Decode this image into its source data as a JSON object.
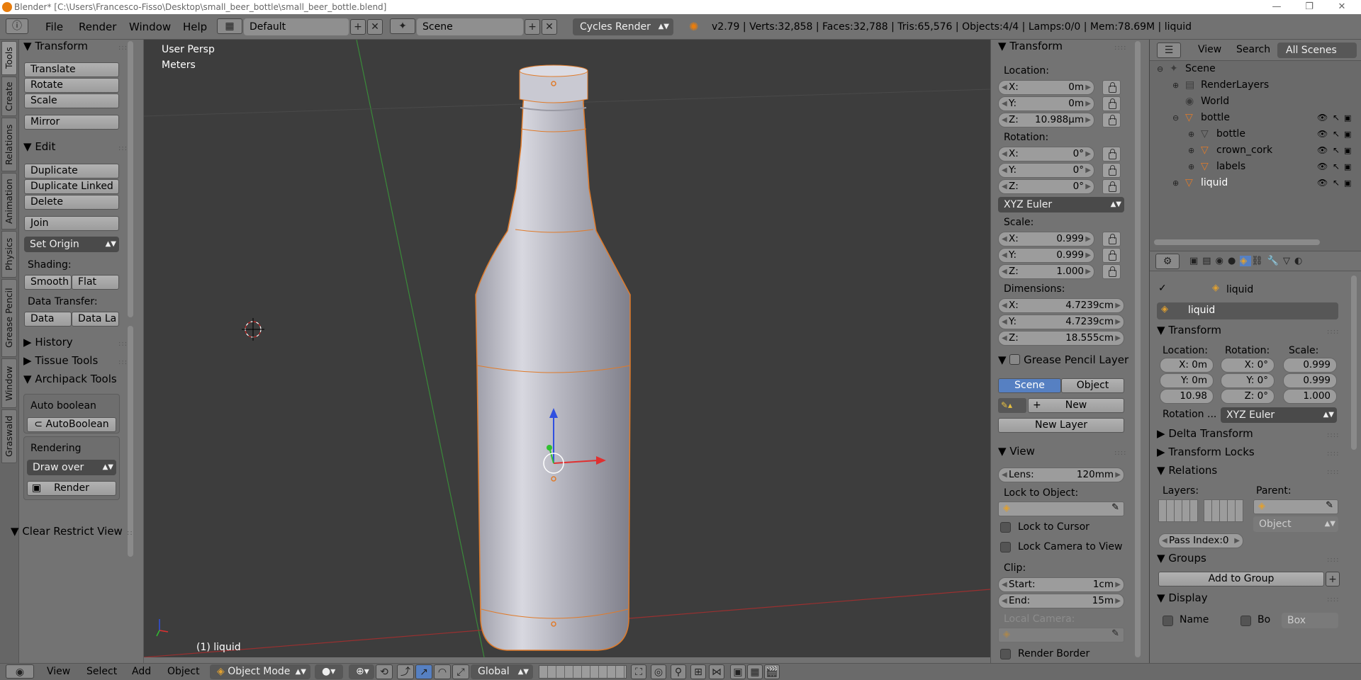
{
  "window": {
    "title": "Blender* [C:\\Users\\Francesco-Fisso\\Desktop\\small_beer_bottle\\small_beer_bottle.blend]",
    "minimize": "—",
    "maximize": "❐",
    "close": "✕"
  },
  "menubar": {
    "items": [
      "File",
      "Render",
      "Window",
      "Help"
    ],
    "layout": "Default",
    "scene": "Scene",
    "engine": "Cycles Render",
    "stats": "v2.79 | Verts:32,858 | Faces:32,788 | Tris:65,576 | Objects:4/4 | Lamps:0/0 | Mem:78.69M | liquid"
  },
  "tabs": [
    "Tools",
    "Create",
    "Relations",
    "Animation",
    "Physics",
    "Grease Pencil",
    "Window",
    "Graswald"
  ],
  "toolpanel": {
    "transform_header": "Transform",
    "translate": "Translate",
    "rotate": "Rotate",
    "scale": "Scale",
    "mirror": "Mirror",
    "edit_header": "Edit",
    "duplicate": "Duplicate",
    "duplicate_linked": "Duplicate Linked",
    "delete": "Delete",
    "join": "Join",
    "set_origin": "Set Origin",
    "shading_label": "Shading:",
    "smooth": "Smooth",
    "flat": "Flat",
    "data_transfer_label": "Data Transfer:",
    "data": "Data",
    "data_la": "Data La",
    "history_header": "History",
    "tissue_header": "Tissue Tools",
    "archipack_header": "Archipack Tools",
    "auto_boolean_label": "Auto boolean",
    "auto_boolean_btn": "AutoBoolean",
    "rendering_label": "Rendering",
    "draw_over": "Draw over",
    "render_btn": "Render",
    "clear_restrict_header": "Clear Restrict View"
  },
  "viewport": {
    "view_name": "User Persp",
    "units": "Meters",
    "object_label": "(1) liquid"
  },
  "npanel": {
    "transform_header": "Transform",
    "location_label": "Location:",
    "loc_x": "0m",
    "loc_y": "0m",
    "loc_z": "10.988µm",
    "rotation_label": "Rotation:",
    "rot_x": "0°",
    "rot_y": "0°",
    "rot_z": "0°",
    "rotation_mode": "XYZ Euler",
    "scale_label": "Scale:",
    "scale_x": "0.999",
    "scale_y": "0.999",
    "scale_z": "1.000",
    "dimensions_label": "Dimensions:",
    "dim_x": "4.7239cm",
    "dim_y": "4.7239cm",
    "dim_z": "18.555cm",
    "gp_header": "Grease Pencil Layer",
    "gp_scene": "Scene",
    "gp_object": "Object",
    "gp_new": "New",
    "gp_new_layer": "New Layer",
    "view_header": "View",
    "lens_label": "Lens:",
    "lens_value": "120mm",
    "lock_to_object": "Lock to Object:",
    "lock_to_cursor": "Lock to Cursor",
    "lock_camera": "Lock Camera to View",
    "clip_label": "Clip:",
    "clip_start_label": "Start:",
    "clip_start": "1cm",
    "clip_end_label": "End:",
    "clip_end": "15m",
    "local_camera": "Local Camera:",
    "render_border": "Render Border",
    "axis_x": "X:",
    "axis_y": "Y:",
    "axis_z": "Z:"
  },
  "outliner": {
    "view": "View",
    "search": "Search",
    "all_scenes": "All Scenes",
    "rows": [
      {
        "label": "Scene",
        "indent": 0
      },
      {
        "label": "RenderLayers",
        "indent": 1
      },
      {
        "label": "World",
        "indent": 1
      },
      {
        "label": "bottle",
        "indent": 1
      },
      {
        "label": "bottle",
        "indent": 2
      },
      {
        "label": "crown_cork",
        "indent": 2
      },
      {
        "label": "labels",
        "indent": 2
      },
      {
        "label": "liquid",
        "indent": 1
      }
    ]
  },
  "props": {
    "breadcrumb": "liquid",
    "object_name": "liquid",
    "transform_header": "Transform",
    "location_label": "Location:",
    "rotation_label": "Rotation:",
    "scale_label": "Scale:",
    "loc": [
      "X: 0m",
      "Y: 0m",
      "10.98"
    ],
    "rot": [
      "X:  0°",
      "Y:  0°",
      "Z:  0°"
    ],
    "scl": [
      "0.999",
      "0.999",
      "1.000"
    ],
    "rotation_mode_label": "Rotation ...",
    "rotation_mode": "XYZ Euler",
    "delta_header": "Delta Transform",
    "locks_header": "Transform Locks",
    "relations_header": "Relations",
    "layers_label": "Layers:",
    "parent_label": "Parent:",
    "parent_type": "Object",
    "pass_index": "Pass Index:0",
    "groups_header": "Groups",
    "add_to_group": "Add to Group",
    "display_header": "Display",
    "name_chk": "Name",
    "bo_chk": "Bo",
    "box": "Box"
  },
  "bottombar": {
    "view": "View",
    "select": "Select",
    "add": "Add",
    "object": "Object",
    "mode": "Object Mode",
    "orientation": "Global"
  },
  "colors": {
    "viewport_bg": "#3d3d3d",
    "panel_bg": "#737373",
    "selection_orange": "#e07b2a",
    "active_blue": "#5680c2"
  }
}
